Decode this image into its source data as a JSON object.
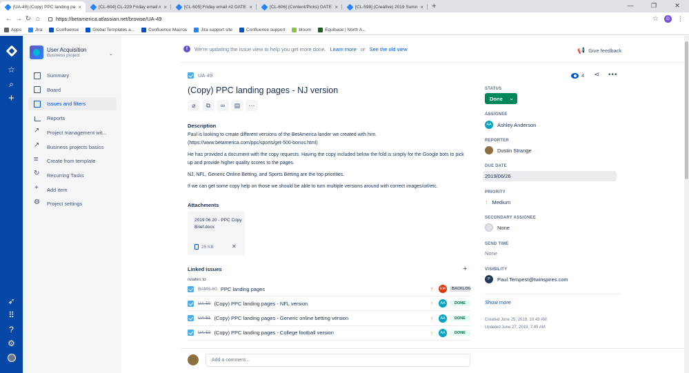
{
  "browser": {
    "tabs": [
      {
        "title": "[UA-49] (Copy) PPC landing pag...",
        "active": true
      },
      {
        "title": "[CL-604] CL-229 Friday email #1",
        "active": false
      },
      {
        "title": "[CL-605] Friday email #2 DATE/TI",
        "active": false
      },
      {
        "title": "[CL-606] (Content/Picks) DATE/R",
        "active": false
      },
      {
        "title": "[CL-598] (Creative) 2019 Summe",
        "active": false
      }
    ],
    "new_tab": "+",
    "url": "https://betamerica.atlassian.net/browse/UA-49",
    "profile_initial": "D",
    "bookmarks": [
      {
        "label": "Apps",
        "color": "#5f6368"
      },
      {
        "label": "Jira",
        "color": "#2684ff"
      },
      {
        "label": "Confluence",
        "color": "#0052cc"
      },
      {
        "label": "Global Templates a...",
        "color": "#0052cc"
      },
      {
        "label": "Confluence Macros",
        "color": "#0052cc"
      },
      {
        "label": "Jira support site",
        "color": "#2684ff"
      },
      {
        "label": "Confluence support",
        "color": "#0052cc"
      },
      {
        "label": "bloom",
        "color": "#8bc34a"
      },
      {
        "label": "Equibase | North A...",
        "color": "#1b5e20"
      }
    ]
  },
  "sidebar": {
    "project_name": "User Acquisition",
    "project_type": "Business project",
    "items": [
      {
        "label": "Summary",
        "icon": "summary-icon",
        "active": false
      },
      {
        "label": "Board",
        "icon": "board-icon",
        "active": false
      },
      {
        "label": "Issues and filters",
        "icon": "issues-icon",
        "active": true
      },
      {
        "label": "Reports",
        "icon": "reports-icon",
        "active": false
      },
      {
        "label": "Project management wit...",
        "icon": "external-link-icon",
        "active": false
      },
      {
        "label": "Business projects basics",
        "icon": "external-link-icon",
        "active": false
      },
      {
        "label": "Create from template",
        "icon": "template-icon",
        "active": false
      },
      {
        "label": "Recurring Tasks",
        "icon": "recurring-icon",
        "active": false
      },
      {
        "label": "Add item",
        "icon": "add-icon",
        "active": false
      },
      {
        "label": "Project settings",
        "icon": "gear-icon",
        "active": false
      }
    ]
  },
  "banner": {
    "text": "We're updating the issue view to help you get more done.",
    "learn_more": "Learn more",
    "or": "or",
    "old_view": "See the old view",
    "feedback": "Give feedback"
  },
  "issue": {
    "key": "UA-49",
    "watchers": "4",
    "title": "(Copy) PPC landing pages - NJ version",
    "description_heading": "Description",
    "description": [
      "Paul is looking to create different versions of the BetAmerica lander we created with him. (https://www.betamerica.com/ppc/sports/get-500-bonus.html)",
      "He has provided a document with the copy requests.  Having the copy included below the fold is simply for the Google bots to pick up and provide higher quality scores to the pages.",
      "NJ, NFL, Generic Online Betting, and Sports Betting are the top priorities.",
      "If we can get some copy help on those we should be able to turn multiple versions around with correct images/url/etc."
    ],
    "attachments_heading": "Attachments",
    "attachment": {
      "name": "2019 06 20 - PPC Copy Brief.docx",
      "size": "25 KB"
    },
    "linked_heading": "Linked issues",
    "relates_to": "relates to",
    "linked": [
      {
        "key": "BAMS-60",
        "summary": "PPC landing pages",
        "priority": "high",
        "assignee": "EM",
        "assignee_color": "#de350b",
        "status": "BACKLOG",
        "done": false
      },
      {
        "key": "UA-50",
        "summary": "(Copy) PPC landing pages - NFL version",
        "priority": "medium",
        "assignee": "AA",
        "assignee_color": "#00a3bf",
        "status": "DONE",
        "done": true
      },
      {
        "key": "UA-51",
        "summary": "(Copy) PPC landing pages - Generic online betting version",
        "priority": "medium",
        "assignee": "AA",
        "assignee_color": "#00a3bf",
        "status": "DONE",
        "done": true
      },
      {
        "key": "UA-52",
        "summary": "(Copy) PPC landing pages - College football version",
        "priority": "medium",
        "assignee": "AA",
        "assignee_color": "#00a3bf",
        "status": "DONE",
        "done": true
      }
    ],
    "comment_placeholder": "Add a comment..."
  },
  "details": {
    "status_label": "STATUS",
    "status": "Done",
    "assignee_label": "ASSIGNEE",
    "assignee": "Ashley Anderson",
    "assignee_initials": "AA",
    "reporter_label": "REPORTER",
    "reporter": "Dustin Strange",
    "due_label": "DUE DATE",
    "due": "2019/06/26",
    "priority_label": "PRIORITY",
    "priority": "Medium",
    "secondary_label": "SECONDARY ASSIGNEE",
    "secondary": "None",
    "send_label": "SEND TIME",
    "send": "None",
    "visibility_label": "VISIBILITY",
    "visibility": "Paul.Tempest@twinspires.com",
    "visibility_initial": "P",
    "show_more": "Show more",
    "created": "Created June 25, 2019, 10:43 AM",
    "updated": "Updated June 27, 2019, 7:49 AM"
  }
}
